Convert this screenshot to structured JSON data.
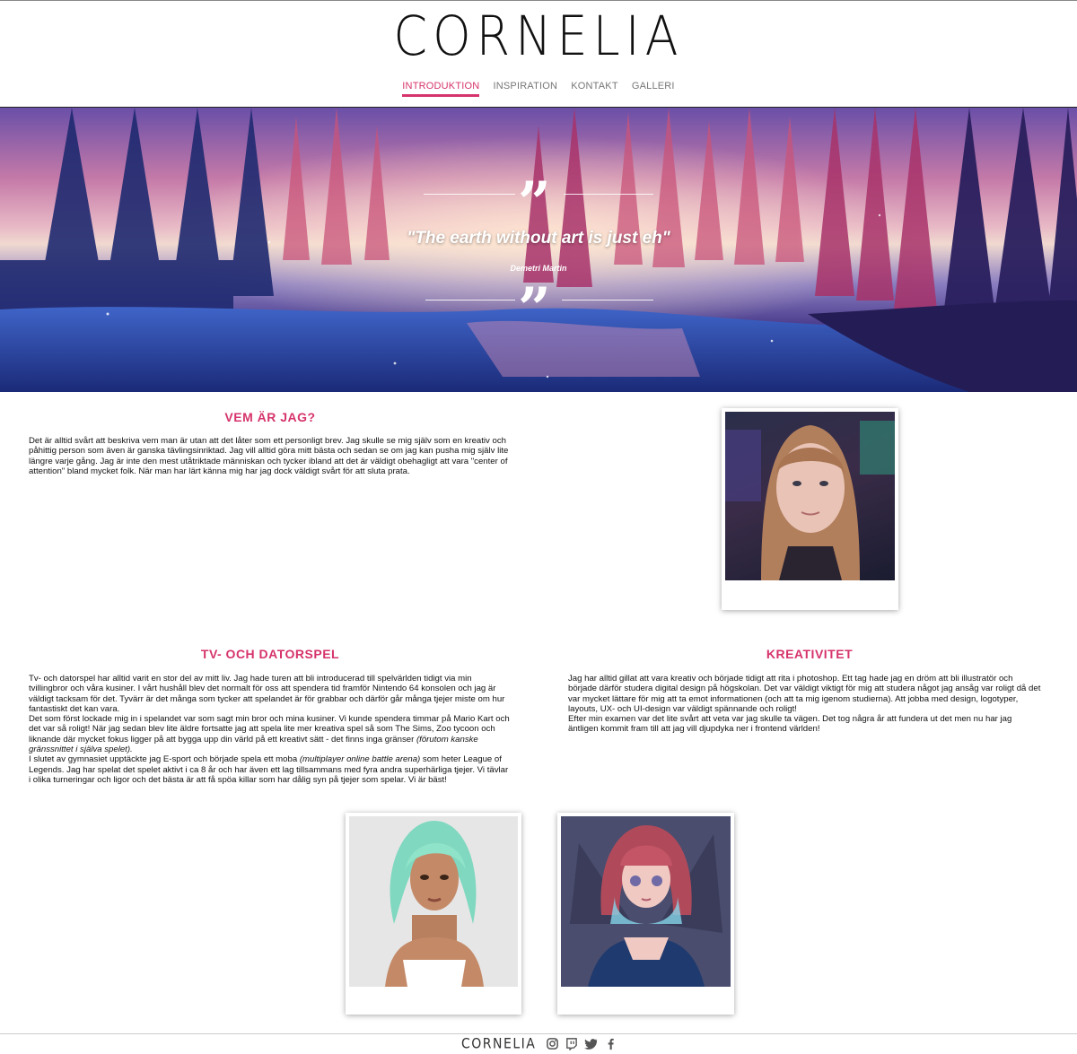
{
  "site": {
    "logo": "CORNELIA",
    "footer_logo": "CORNELIA"
  },
  "nav": {
    "items": [
      "INTRODUKTION",
      "INSPIRATION",
      "KONTAKT",
      "GALLERI"
    ],
    "active": "INTRODUKTION"
  },
  "hero": {
    "quote": "\"The earth without art is just eh\"",
    "author": "Demetri Martin"
  },
  "about": {
    "heading": "VEM ÄR JAG?",
    "text": "Det är alltid svårt att beskriva vem man är utan att det låter som ett personligt brev. Jag skulle se mig själv som en kreativ och påhittig person som även är ganska tävlingsinriktad. Jag vill alltid göra mitt bästa och sedan se om jag kan pusha mig själv lite längre varje gång. Jag är inte den mest utåtriktade människan och tycker ibland att det är väldigt obehagligt att vara \"center of attention\" bland mycket folk. När man har lärt känna mig har jag dock väldigt svårt för att sluta prata."
  },
  "games": {
    "heading": "TV- OCH DATORSPEL",
    "p1": "Tv- och datorspel har alltid varit en stor del av mitt liv. Jag hade turen att bli introducerad till spelvärlden tidigt via min tvillingbror och våra kusiner. I vårt hushåll blev det normalt för oss att spendera tid framför Nintendo 64 konsolen och jag är väldigt tacksam för det. Tyvärr är det många som tycker att spelandet är för grabbar och därför går många tjejer miste om hur fantastiskt det kan vara.",
    "p2a": "Det som först lockade mig in i spelandet var som sagt min bror och mina kusiner. Vi kunde spendera timmar på Mario Kart och det var så roligt! När jag sedan blev lite äldre fortsatte jag att spela lite mer kreativa spel så som The Sims, Zoo tycoon och liknande där mycket fokus ligger på att bygga upp din värld på ett kreativt sätt - det finns inga gränser ",
    "p2b": "(förutom kanske gränssnittet i själva spelet).",
    "p3a": "I slutet av gymnasiet upptäckte jag E-sport och började spela ett moba ",
    "p3b": "(multiplayer online battle arena)",
    "p3c": " som heter League of Legends. Jag har spelat det spelet aktivt i ca 8 år och har även ett lag tillsammans med fyra andra superhärliga tjejer. Vi tävlar i olika turneringar och ligor och det bästa är att få spöa killar som har dålig syn på tjejer som spelar. Vi är bäst!"
  },
  "creativity": {
    "heading": "KREATIVITET",
    "p1": "Jag har alltid gillat att vara kreativ och började tidigt att rita i photoshop. Ett tag hade jag en dröm att bli illustratör och började därför studera digital design på högskolan. Det var väldigt viktigt för mig att studera något jag ansåg var roligt då det var mycket lättare för mig att ta emot informationen (och att ta mig igenom studierna). Att jobba med design, logotyper, layouts, UX- och UI-design var väldigt spännande och roligt!",
    "p2": "Efter min examen var det lite svårt att veta var jag skulle ta vägen. Det tog några år att fundera ut det men nu har jag äntligen kommit fram till att jag vill djupdyka ner i frontend världen!"
  },
  "footer": {
    "social": [
      "instagram-icon",
      "twitch-icon",
      "twitter-icon",
      "facebook-icon"
    ]
  },
  "colors": {
    "accent": "#d6336c",
    "nav_text": "#777777"
  }
}
